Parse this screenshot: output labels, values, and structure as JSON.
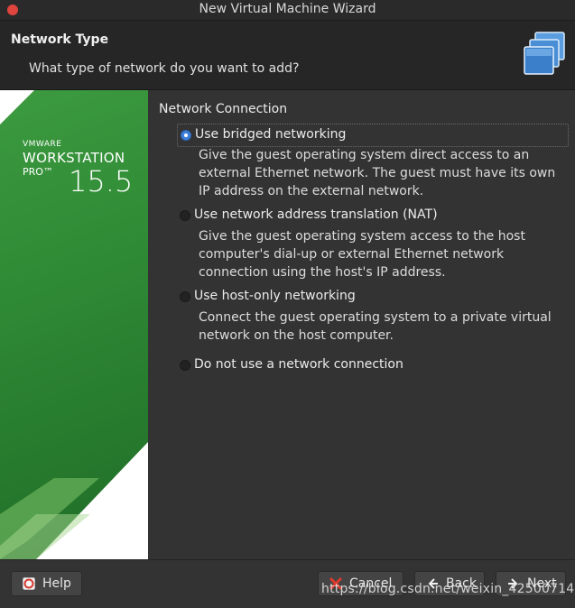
{
  "window": {
    "title": "New Virtual Machine Wizard"
  },
  "header": {
    "title": "Network Type",
    "subtitle": "What type of network do you want to add?"
  },
  "banner": {
    "brand_small": "VMWARE",
    "brand_product": "WORKSTATION",
    "brand_edition": "PRO™",
    "version": "15.5"
  },
  "content": {
    "section_title": "Network Connection",
    "options": [
      {
        "label": "Use bridged networking",
        "selected": true,
        "description": "Give the guest operating system direct access to an external Ethernet network. The guest must have its own IP address on the external network."
      },
      {
        "label": "Use network address translation (NAT)",
        "selected": false,
        "description": "Give the guest operating system access to the host computer's dial-up or external Ethernet network connection using the host's IP address."
      },
      {
        "label": "Use host-only networking",
        "selected": false,
        "description": "Connect the guest operating system to a private virtual network on the host computer."
      },
      {
        "label": "Do not use a network connection",
        "selected": false,
        "description": ""
      }
    ]
  },
  "footer": {
    "help_label": "Help",
    "cancel_label": "Cancel",
    "back_label": "Back",
    "next_label": "Next",
    "watermark": "https://blog.csdn.net/weixin_42500714"
  },
  "colors": {
    "accent": "#3d7fd9",
    "brand_green": "#2f8a35",
    "close_red": "#e0443e"
  },
  "icons": {
    "close": "close-dot-icon",
    "wizard": "network-wizard-icon",
    "help": "help-lifebuoy-icon",
    "cancel": "red-x-icon",
    "back": "chevron-left-icon",
    "next": "chevron-right-icon"
  }
}
